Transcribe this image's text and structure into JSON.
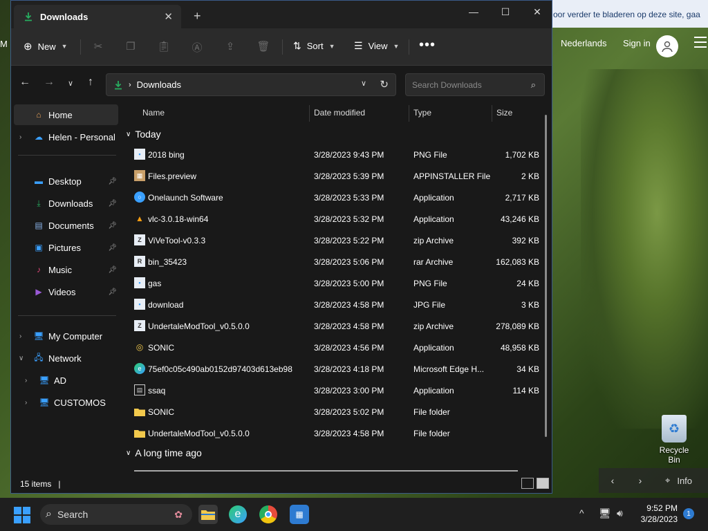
{
  "browser": {
    "cookie_text": "oor verder te bladeren op deze site, gaa",
    "language": "Nederlands",
    "sign_in": "Sign in",
    "left_letter": "M"
  },
  "desktop": {
    "recycle_bin": "Recycle Bin"
  },
  "spotlight": {
    "info": "Info"
  },
  "window": {
    "tab_title": "Downloads",
    "toolbar": {
      "new": "New",
      "sort": "Sort",
      "view": "View"
    },
    "address": {
      "location": "Downloads"
    },
    "search": {
      "placeholder": "Search Downloads"
    },
    "sidebar": {
      "home": "Home",
      "personal": "Helen - Personal",
      "pinned": [
        "Desktop",
        "Downloads",
        "Documents",
        "Pictures",
        "Music",
        "Videos"
      ],
      "my_computer": "My Computer",
      "network": "Network",
      "network_children": [
        "AD",
        "CUSTOMOS"
      ]
    },
    "columns": {
      "name": "Name",
      "date": "Date modified",
      "type": "Type",
      "size": "Size"
    },
    "groups": {
      "today": "Today",
      "long_ago": "A long time ago"
    },
    "files": [
      {
        "name": "2018 bing",
        "date": "3/28/2023 9:43 PM",
        "type": "PNG File",
        "size": "1,702 KB",
        "icon": "image-file-icon"
      },
      {
        "name": "Files.preview",
        "date": "3/28/2023 5:39 PM",
        "type": "APPINSTALLER File",
        "size": "2 KB",
        "icon": "package-icon"
      },
      {
        "name": "Onelaunch Software",
        "date": "3/28/2023 5:33 PM",
        "type": "Application",
        "size": "2,717 KB",
        "icon": "onelaunch-icon"
      },
      {
        "name": "vlc-3.0.18-win64",
        "date": "3/28/2023 5:32 PM",
        "type": "Application",
        "size": "43,246 KB",
        "icon": "vlc-icon"
      },
      {
        "name": "ViVeTool-v0.3.3",
        "date": "3/28/2023 5:22 PM",
        "type": "zip Archive",
        "size": "392 KB",
        "icon": "zip-icon"
      },
      {
        "name": "bin_35423",
        "date": "3/28/2023 5:06 PM",
        "type": "rar Archive",
        "size": "162,083 KB",
        "icon": "rar-icon"
      },
      {
        "name": "gas",
        "date": "3/28/2023 5:00 PM",
        "type": "PNG File",
        "size": "24 KB",
        "icon": "image-file-icon"
      },
      {
        "name": "download",
        "date": "3/28/2023 4:58 PM",
        "type": "JPG File",
        "size": "3 KB",
        "icon": "image-file-icon"
      },
      {
        "name": "UndertaleModTool_v0.5.0.0",
        "date": "3/28/2023 4:58 PM",
        "type": "zip Archive",
        "size": "278,089 KB",
        "icon": "zip-icon"
      },
      {
        "name": "SONIC",
        "date": "3/28/2023 4:56 PM",
        "type": "Application",
        "size": "48,958 KB",
        "icon": "app-icon"
      },
      {
        "name": "75ef0c05c490ab0152d97403d613eb98",
        "date": "3/28/2023 4:18 PM",
        "type": "Microsoft Edge H...",
        "size": "34 KB",
        "icon": "edge-icon"
      },
      {
        "name": "ssaq",
        "date": "3/28/2023 3:00 PM",
        "type": "Application",
        "size": "114 KB",
        "icon": "app-icon"
      },
      {
        "name": "SONIC",
        "date": "3/28/2023 5:02 PM",
        "type": "File folder",
        "size": "",
        "icon": "folder-icon"
      },
      {
        "name": "UndertaleModTool_v0.5.0.0",
        "date": "3/28/2023 4:58 PM",
        "type": "File folder",
        "size": "",
        "icon": "folder-icon"
      }
    ],
    "status": "15 items"
  },
  "taskbar": {
    "search": "Search",
    "time": "9:52 PM",
    "date": "3/28/2023",
    "notifications": "1"
  },
  "colors": {
    "accent": "#3aa0ff",
    "window_bg": "#191919",
    "folder": "#f2c94c",
    "download_green": "#27ae60"
  }
}
